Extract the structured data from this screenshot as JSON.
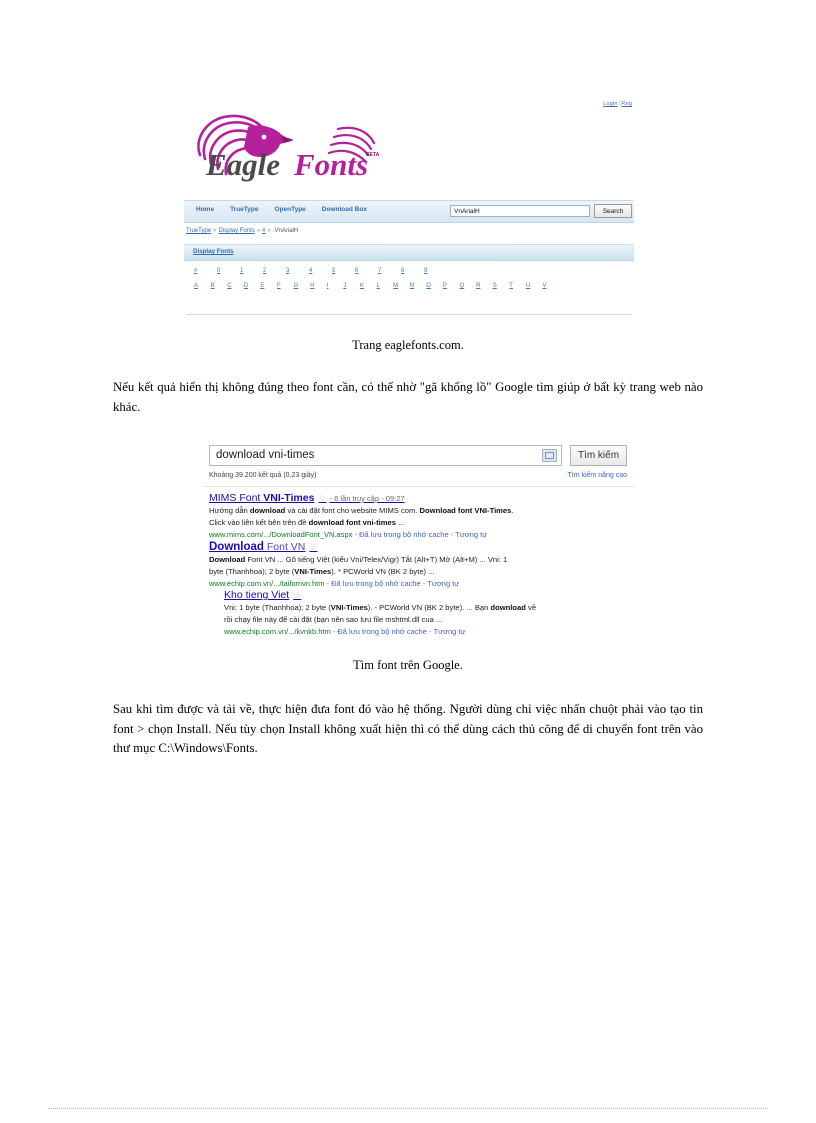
{
  "document": {
    "captions": {
      "eaglefonts": "Trang eaglefonts.com.",
      "google": "Tìm font trên Google."
    },
    "paragraphs": {
      "p1": "Nếu kết quả hiển thị không đúng theo font cần, có thể nhờ \"gã khổng lồ\" Google tìm giúp ở bất kỳ trang web nào khác.",
      "p2": "Sau khi tìm được và tải về, thực hiện đưa font đó vào hệ thống. Người dùng chỉ việc nhấn chuột phải vào tạo tin font > chọn Install. Nếu tùy chọn Install không xuất hiện thì có thể dùng cách thủ công để di chuyển font trên vào thư mục C:\\Windows\\Fonts."
    }
  },
  "eaglefonts": {
    "account": {
      "login": "Login",
      "separator": "|",
      "register": "Reg"
    },
    "logo": {
      "word_one": "Eagle",
      "word_two": "Fonts",
      "beta": "BETA",
      "eagle_color": "#b5219b",
      "text_color": "#4a4a4a"
    },
    "nav": {
      "items": [
        "Home",
        "TrueType",
        "OpenType",
        "Download Box"
      ]
    },
    "search": {
      "value": "VnArialH",
      "placeholder": "",
      "button_label": "Search"
    },
    "breadcrumb": {
      "items": [
        "TrueType",
        "Display Fonts",
        "#"
      ],
      "separator": "»",
      "current": ".VnArialH"
    },
    "section": {
      "title": "Display Fonts"
    },
    "alpha_rows": [
      [
        "#",
        "0",
        "1",
        "2",
        "3",
        "4",
        "5",
        "6",
        "7",
        "8",
        "9"
      ],
      [
        "A",
        "B",
        "C",
        "D",
        "E",
        "F",
        "G",
        "H",
        "I",
        "J",
        "K",
        "L",
        "M",
        "N",
        "O",
        "P",
        "Q",
        "R",
        "S",
        "T",
        "U",
        "V"
      ]
    ]
  },
  "google": {
    "search": {
      "query": "download vni-times",
      "button_label": "Tìm kiếm",
      "mic_icon": "keyboard-icon"
    },
    "stats": "Khoảng 39.200 kết quả (0,23 giây)",
    "advanced_link": "Tìm kiếm nâng cao",
    "results": [
      {
        "title_plain": "MIMS Font ",
        "title_bold": "VNI-Times",
        "star": "☆",
        "meta": "- 6 lần truy cập - 09:27",
        "snippet_line1_a": "Hướng dẫn ",
        "snippet_line1_b": "download",
        "snippet_line1_c": " và cài đặt font cho website MIMS com. ",
        "snippet_line1_d": "Download font VNI-Times",
        "snippet_line1_e": ".",
        "snippet_line2_a": "Click vào liên kết bên trên đề ",
        "snippet_line2_b": "download font vni-times",
        "snippet_line2_c": " ...",
        "url": "www.mims.com/.../DownloadFont_VN.aspx",
        "cache": "Đã lưu trong bộ nhớ cache",
        "similar": "Tương tự"
      },
      {
        "title_lead": "Download",
        "title_rest": " Font VN",
        "star": "☆",
        "snippet_line1_a": "Download",
        "snippet_line1_b": " Font VN ... Gõ tiếng Việt (kiểu Vni/Telex/Vigr) Tắt (Alt+T) Mở (Alt+M) ... Vni: 1",
        "snippet_line2_a": "byte (Thanhhoa); 2 byte (",
        "snippet_line2_b": "VNI-Times",
        "snippet_line2_c": "). * PCWorld VN (BK 2 byte) ...",
        "url": "www.echip.com.vn/.../taifomvn.htm",
        "cache": "Đã lưu trong bộ nhớ cache",
        "similar": "Tương tự"
      },
      {
        "title_plain": "Kho tieng Viet",
        "star": "☆",
        "snippet_line1_a": "Vni: 1 byte (Thanhhoa); 2 byte (",
        "snippet_line1_b": "VNI-Times",
        "snippet_line1_c": "). - PCWorld VN (BK 2 byte). ... Bạn ",
        "snippet_line1_d": "download",
        "snippet_line1_e": " về",
        "snippet_line2": "rồi chạy file này để cài đặt (bạn nên sao lưu file mshtml.dll cua ...",
        "url": "www.echip.com.vn/.../kvnkb.htm",
        "cache": "Đã lưu trong bộ nhớ cache",
        "similar": "Tương tự"
      }
    ]
  }
}
